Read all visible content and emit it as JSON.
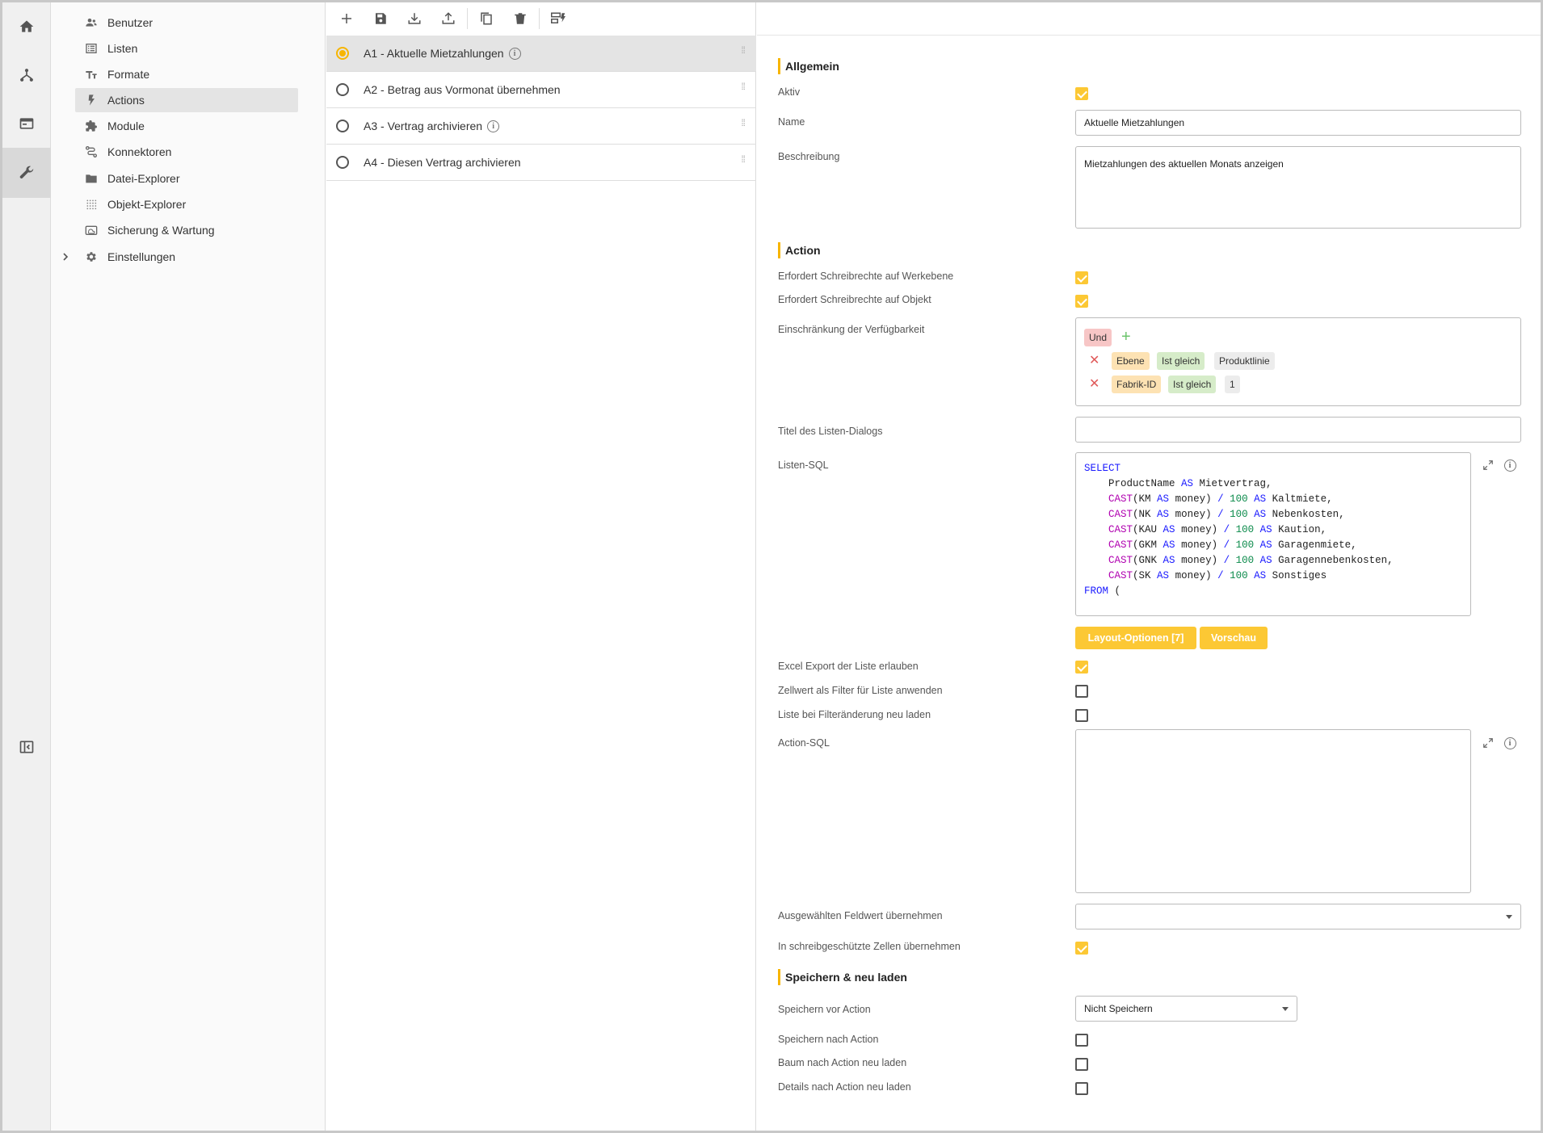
{
  "rail": {
    "items": [
      "home-icon",
      "hierarchy-icon",
      "window-icon",
      "wrench-icon"
    ],
    "collapse_icon": "panel-collapse-icon"
  },
  "nav": {
    "items": [
      {
        "label": "Benutzer",
        "icon": "users-icon"
      },
      {
        "label": "Listen",
        "icon": "list-icon"
      },
      {
        "label": "Formate",
        "icon": "text-format-icon"
      },
      {
        "label": "Actions",
        "icon": "lightning-icon"
      },
      {
        "label": "Module",
        "icon": "puzzle-icon"
      },
      {
        "label": "Konnektoren",
        "icon": "connector-icon"
      },
      {
        "label": "Datei-Explorer",
        "icon": "folder-icon"
      },
      {
        "label": "Objekt-Explorer",
        "icon": "grid-dots-icon"
      },
      {
        "label": "Sicherung & Wartung",
        "icon": "backup-icon"
      },
      {
        "label": "Einstellungen",
        "icon": "gear-icon"
      }
    ],
    "active_index": 3
  },
  "list": {
    "toolbar": [
      "add-icon",
      "save-icon",
      "import-icon",
      "export-icon",
      "copy-icon",
      "delete-icon",
      "layout-action-icon"
    ],
    "rows": [
      {
        "label": "A1 - Aktuelle Mietzahlungen",
        "info": true
      },
      {
        "label": "A2 - Betrag aus Vormonat übernehmen",
        "info": false
      },
      {
        "label": "A3 - Vertrag archivieren",
        "info": true
      },
      {
        "label": "A4 - Diesen Vertrag archivieren",
        "info": false
      }
    ],
    "selected_index": 0
  },
  "detail": {
    "sections": {
      "general": "Allgemein",
      "action": "Action",
      "save": "Speichern & neu laden"
    },
    "labels": {
      "aktiv": "Aktiv",
      "name": "Name",
      "beschreibung": "Beschreibung",
      "schreib_werk": "Erfordert Schreibrechte auf Werkebene",
      "schreib_objekt": "Erfordert Schreibrechte auf Objekt",
      "einschraenkung": "Einschränkung der Verfügbarkeit",
      "titel_dialog": "Titel des Listen-Dialogs",
      "listen_sql": "Listen-SQL",
      "excel": "Excel Export der Liste erlauben",
      "zellwert": "Zellwert als Filter für Liste anwenden",
      "filteraenderung": "Liste bei Filteränderung neu laden",
      "action_sql": "Action-SQL",
      "feldwert": "Ausgewählten Feldwert übernehmen",
      "schreibgeschuetzt": "In schreibgeschützte Zellen übernehmen",
      "speichern_vor": "Speichern vor Action",
      "speichern_nach": "Speichern nach Action",
      "baum": "Baum nach Action neu laden",
      "details": "Details nach Action neu laden"
    },
    "values": {
      "name": "Aktuelle Mietzahlungen",
      "beschreibung": "Mietzahlungen des aktuellen Monats anzeigen",
      "titel_dialog": "",
      "action_sql": "",
      "feldwert": "",
      "speichern_vor": "Nicht Speichern"
    },
    "checks": {
      "aktiv": true,
      "schreib_werk": true,
      "schreib_objekt": true,
      "excel": true,
      "zellwert": false,
      "filteraenderung": false,
      "schreibgeschuetzt": true,
      "speichern_nach": false,
      "baum": false,
      "details": false
    },
    "filter": {
      "operator": "Und",
      "rows": [
        [
          "Ebene",
          "Ist gleich",
          "Produktlinie"
        ],
        [
          "Fabrik-ID",
          "Ist gleich",
          "1"
        ]
      ]
    },
    "sql_lines": [
      "SELECT",
      "    ProductName AS Mietvertrag,",
      "    CAST(KM AS money) / 100 AS Kaltmiete,",
      "    CAST(NK AS money) / 100 AS Nebenkosten,",
      "    CAST(KAU AS money) / 100 AS Kaution,",
      "    CAST(GKM AS money) / 100 AS Garagenmiete,",
      "    CAST(GNK AS money) / 100 AS Garagennebenkosten,",
      "    CAST(SK AS money) / 100 AS Sonstiges",
      "FROM ("
    ],
    "buttons": {
      "layout": "Layout-Optionen [7]",
      "preview": "Vorschau"
    }
  },
  "colors": {
    "accent": "#fcc834",
    "keyword": "#1a1aff",
    "function": "#b000b0",
    "number": "#0a8a4a"
  }
}
